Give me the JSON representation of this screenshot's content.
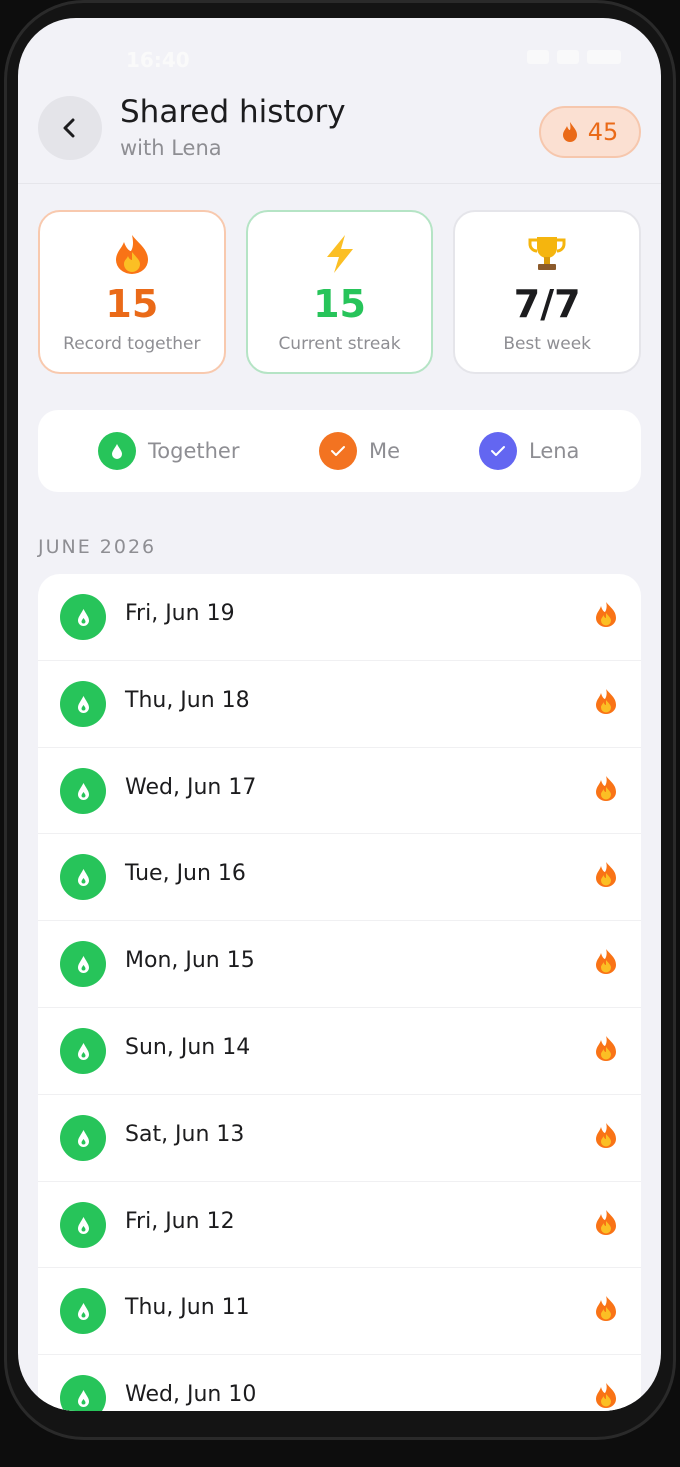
{
  "status_bar": {
    "time": "16:40"
  },
  "header": {
    "title": "Shared history",
    "subtitle": "with Lena",
    "streak_badge": "45"
  },
  "stats": [
    {
      "value": "15",
      "label": "Record together",
      "icon": "flame-icon",
      "color": "#ea6a18"
    },
    {
      "value": "15",
      "label": "Current streak",
      "icon": "lightning-icon",
      "color": "#27c45a"
    },
    {
      "value": "7/7",
      "label": "Best week",
      "icon": "trophy-icon",
      "color": "#1c1c1e"
    }
  ],
  "legend": [
    {
      "label": "Together",
      "color": "#27c45a",
      "icon": "drop-icon"
    },
    {
      "label": "Me",
      "color": "#f37321",
      "icon": "check-icon"
    },
    {
      "label": "Lena",
      "color": "#6366f1",
      "icon": "check-icon"
    }
  ],
  "history": {
    "month": "JUNE 2026",
    "days": [
      {
        "date": "Fri, Jun 19",
        "status": "together"
      },
      {
        "date": "Thu, Jun 18",
        "status": "together"
      },
      {
        "date": "Wed, Jun 17",
        "status": "together"
      },
      {
        "date": "Tue, Jun 16",
        "status": "together"
      },
      {
        "date": "Mon, Jun 15",
        "status": "together"
      },
      {
        "date": "Sun, Jun 14",
        "status": "together"
      },
      {
        "date": "Sat, Jun 13",
        "status": "together"
      },
      {
        "date": "Fri, Jun 12",
        "status": "together"
      },
      {
        "date": "Thu, Jun 11",
        "status": "together"
      },
      {
        "date": "Wed, Jun 10",
        "status": "together"
      }
    ]
  }
}
